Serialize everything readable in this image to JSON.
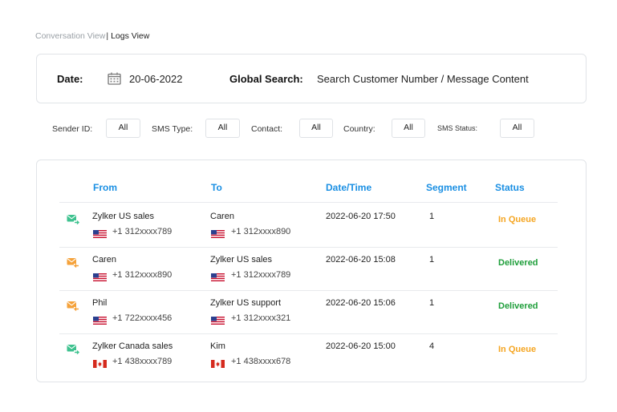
{
  "breadcrumb": {
    "conversation_view": "Conversation View",
    "separator": "|",
    "logs_view": "Logs View"
  },
  "search": {
    "date_label": "Date:",
    "date_value": "20-06-2022",
    "global_search_label": "Global Search:",
    "global_search_placeholder": "Search Customer Number / Message Content",
    "calendar_icon": "calendar-icon"
  },
  "filters": {
    "sender_id": {
      "label": "Sender ID:",
      "value": "All"
    },
    "sms_type": {
      "label": "SMS Type:",
      "value": "All"
    },
    "contact": {
      "label": "Contact:",
      "value": "All"
    },
    "country": {
      "label": "Country:",
      "value": "All"
    },
    "sms_status": {
      "label": "SMS Status:",
      "value": "All"
    }
  },
  "table": {
    "headers": {
      "from": "From",
      "to": "To",
      "datetime": "Date/Time",
      "segment": "Segment",
      "status": "Status"
    },
    "rows": [
      {
        "direction": "outgoing",
        "from_name": "Zylker US sales",
        "from_flag": "us",
        "from_number": "+1 312xxxx789",
        "to_name": "Caren",
        "to_flag": "us",
        "to_number": "+1 312xxxx890",
        "datetime": "2022-06-20 17:50",
        "segment": "1",
        "status": "In Queue"
      },
      {
        "direction": "incoming",
        "from_name": "Caren",
        "from_flag": "us",
        "from_number": "+1 312xxxx890",
        "to_name": "Zylker US sales",
        "to_flag": "us",
        "to_number": "+1 312xxxx789",
        "datetime": "2022-06-20 15:08",
        "segment": "1",
        "status": "Delivered"
      },
      {
        "direction": "incoming",
        "from_name": "Phil",
        "from_flag": "us",
        "from_number": "+1 722xxxx456",
        "to_name": "Zylker US support",
        "to_flag": "us",
        "to_number": "+1 312xxxx321",
        "datetime": "2022-06-20 15:06",
        "segment": "1",
        "status": "Delivered"
      },
      {
        "direction": "outgoing",
        "from_name": "Zylker Canada sales",
        "from_flag": "ca",
        "from_number": "+1 438xxxx789",
        "to_name": "Kim",
        "to_flag": "ca",
        "to_number": "+1 438xxxx678",
        "datetime": "2022-06-20 15:00",
        "segment": "4",
        "status": "In Queue"
      }
    ]
  },
  "colors": {
    "accent": "#1a8fe3",
    "outgoing_icon": "#3ec28f",
    "incoming_icon": "#f5a23a",
    "status_in_queue": "#f5a623",
    "status_delivered": "#1e9e3a"
  }
}
